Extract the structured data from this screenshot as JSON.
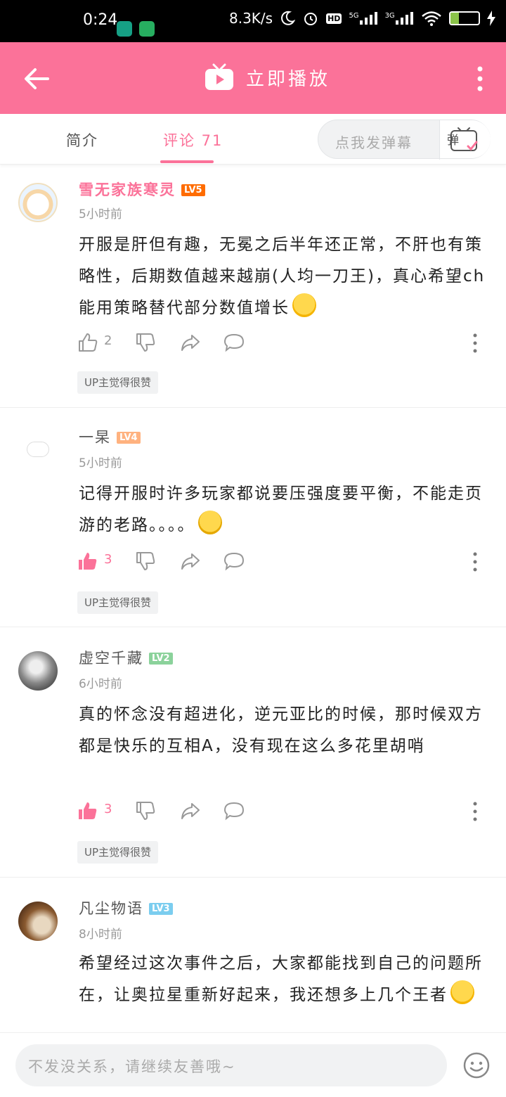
{
  "status_bar": {
    "time": "0:24",
    "net_speed": "8.3K/s",
    "signal_1": "5G",
    "signal_2": "3G",
    "hd": "HD",
    "battery": "32",
    "battery_level": 0.32
  },
  "header": {
    "title": "立即播放"
  },
  "tabs": {
    "intro": "简介",
    "comments": "评论 71"
  },
  "danmaku": {
    "placeholder": "点我发弹幕",
    "button_label": "弹"
  },
  "comments": [
    {
      "username": "雪无家族寒灵",
      "level": "LV5",
      "level_color": "#ff6c00",
      "name_color": "#fb7299",
      "time": "5小时前",
      "text": "开服是肝但有趣，无冕之后半年还正常，不肝也有策略性，后期数值越来越崩(人均一刀王)，真心希望ch能用策略替代部分数值增长",
      "emoji": "crying-laugh-emoji",
      "likes": "2",
      "liked": false,
      "badge": "UP主觉得很赞"
    },
    {
      "username": "一杲",
      "level": "LV4",
      "level_color": "#ffb27f",
      "name_color": "#555555",
      "time": "5小时前",
      "text": "记得开服时许多玩家都说要压强度要平衡，不能走页游的老路。。。。",
      "emoji": "smirk-emoji",
      "likes": "3",
      "liked": true,
      "badge": "UP主觉得很赞"
    },
    {
      "username": "虚空千藏",
      "level": "LV2",
      "level_color": "#8bd29b",
      "name_color": "#555555",
      "time": "6小时前",
      "text": "真的怀念没有超进化，逆元亚比的时候，那时候双方都是快乐的互相A，没有现在这么多花里胡哨",
      "emoji": "",
      "likes": "3",
      "liked": true,
      "badge": "UP主觉得很赞"
    },
    {
      "username": "凡尘物语",
      "level": "LV3",
      "level_color": "#7bcdef",
      "name_color": "#555555",
      "time": "8小时前",
      "text": "希望经过这次事件之后，大家都能找到自己的问题所在，让奥拉星重新好起来，我还想多上几个王者",
      "emoji": "scared-emoji",
      "likes": "",
      "liked": false,
      "badge": ""
    }
  ],
  "bottom": {
    "placeholder": "不发没关系，请继续友善哦~"
  },
  "colors": {
    "brand": "#fb7299",
    "muted": "#999999"
  }
}
